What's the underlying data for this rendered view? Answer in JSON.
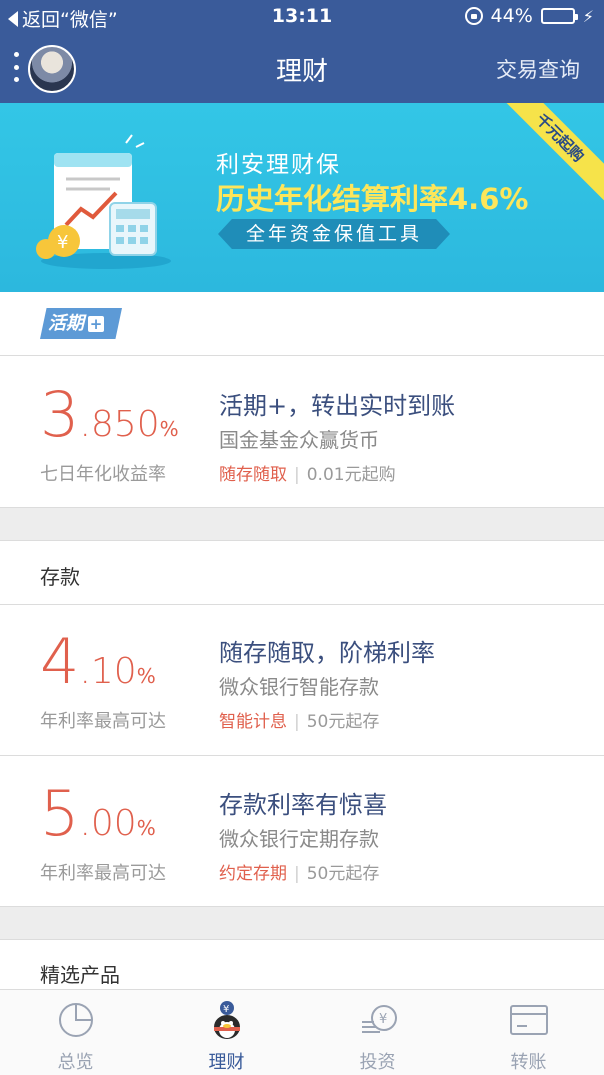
{
  "status_bar": {
    "back_label": "返回“微信”",
    "time": "13:11",
    "battery": "44%",
    "battery_level": 0.44
  },
  "nav": {
    "title": "理财",
    "right_action": "交易查询"
  },
  "banner": {
    "line1": "利安理财保",
    "line2": "历史年化结算利率4.6%",
    "pill": "全年资金保值工具",
    "ribbon": "千元起购"
  },
  "huoqi": {
    "tag": "活期",
    "tag_plus": "+",
    "product": {
      "rate_int": "3",
      "rate_dec": ".850",
      "rate_unit": "%",
      "rate_label": "七日年化收益率",
      "title": "活期+，转出实时到账",
      "subtitle": "国金基金众赢货币",
      "highlight": "随存随取",
      "min": "0.01元起购"
    }
  },
  "deposit": {
    "section_title": "存款",
    "products": [
      {
        "rate_int": "4",
        "rate_dec": ".10",
        "rate_unit": "%",
        "rate_label": "年利率最高可达",
        "title": "随存随取，阶梯利率",
        "subtitle": "微众银行智能存款",
        "highlight": "智能计息",
        "min": "50元起存"
      },
      {
        "rate_int": "5",
        "rate_dec": ".00",
        "rate_unit": "%",
        "rate_label": "年利率最高可达",
        "title": "存款利率有惊喜",
        "subtitle": "微众银行定期存款",
        "highlight": "约定存期",
        "min": "50元起存"
      }
    ]
  },
  "featured": {
    "section_title": "精选产品"
  },
  "tabbar": {
    "tabs": [
      {
        "label": "总览",
        "icon": "pie-chart-icon"
      },
      {
        "label": "理财",
        "icon": "penguin-coin-icon",
        "active": true
      },
      {
        "label": "投资",
        "icon": "coins-icon"
      },
      {
        "label": "转账",
        "icon": "card-icon"
      }
    ]
  },
  "colors": {
    "nav_bg": "#3a5b9a",
    "rate": "#e0604d",
    "banner_bg": "#33c6e6",
    "banner_highlight": "#fde65a"
  }
}
